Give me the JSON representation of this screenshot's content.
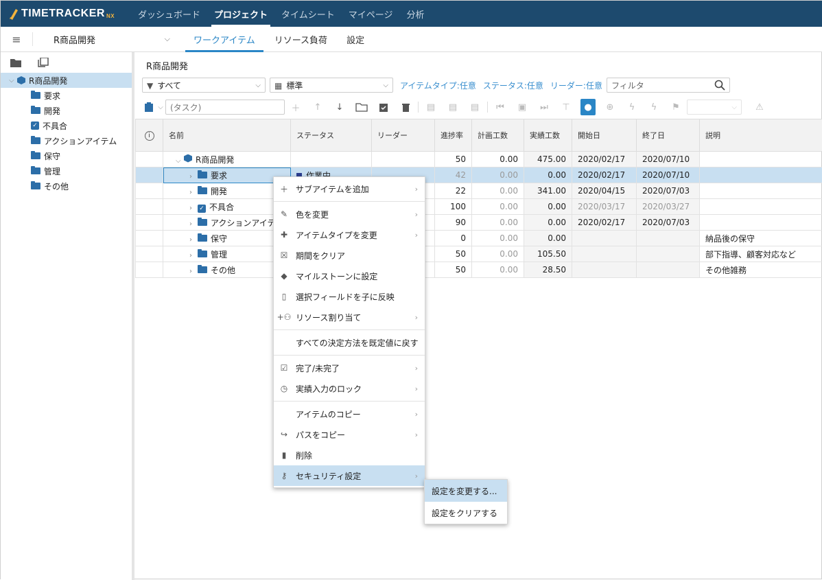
{
  "nav": {
    "logo": "TIMETRACKER",
    "logo_suffix": "NX",
    "items": [
      {
        "label": "ダッシュボード",
        "active": false
      },
      {
        "label": "プロジェクト",
        "active": true
      },
      {
        "label": "タイムシート",
        "active": false
      },
      {
        "label": "マイページ",
        "active": false
      },
      {
        "label": "分析",
        "active": false
      }
    ]
  },
  "subheader": {
    "project": "R商品開発",
    "tabs": [
      {
        "label": "ワークアイテム",
        "active": true
      },
      {
        "label": "リソース負荷",
        "active": false
      },
      {
        "label": "設定",
        "active": false
      }
    ]
  },
  "sidebar": {
    "root": "R商品開発",
    "items": [
      {
        "label": "要求",
        "icon": "folder-icon"
      },
      {
        "label": "開発",
        "icon": "folder-icon"
      },
      {
        "label": "不具合",
        "icon": "checkbox-icon"
      },
      {
        "label": "アクションアイテム",
        "icon": "folder-icon"
      },
      {
        "label": "保守",
        "icon": "folder-icon"
      },
      {
        "label": "管理",
        "icon": "folder-icon"
      },
      {
        "label": "その他",
        "icon": "folder-icon"
      }
    ]
  },
  "main": {
    "title": "R商品開発",
    "filter_select": "すべて",
    "view_select": "標準",
    "filter_links": [
      "アイテムタイプ:任意",
      "ステータス:任意",
      "リーダー:任意"
    ],
    "filter_placeholder": "フィルタ",
    "task_placeholder": "(タスク)"
  },
  "grid": {
    "columns": [
      "名前",
      "ステータス",
      "リーダー",
      "進捗率",
      "計画工数",
      "実績工数",
      "開始日",
      "終了日",
      "説明"
    ],
    "rows": [
      {
        "name": "R商品開発",
        "type": "root",
        "status": "",
        "leader": "",
        "progress": "50",
        "planned": "0.00",
        "actual": "475.00",
        "start": "2020/02/17",
        "end": "2020/07/10",
        "desc": ""
      },
      {
        "name": "要求",
        "type": "folder",
        "status": "作業中",
        "leader": "",
        "progress": "42",
        "planned": "0.00",
        "actual": "0.00",
        "start": "2020/02/17",
        "end": "2020/07/10",
        "desc": "",
        "selected": true
      },
      {
        "name": "開発",
        "type": "folder",
        "status": "",
        "leader": "",
        "progress": "22",
        "planned": "0.00",
        "actual": "341.00",
        "start": "2020/04/15",
        "end": "2020/07/03",
        "desc": ""
      },
      {
        "name": "不具合",
        "type": "check",
        "status": "",
        "leader": "",
        "progress": "100",
        "planned": "0.00",
        "actual": "0.00",
        "start": "2020/03/17",
        "end": "2020/03/27",
        "desc": "",
        "dimdates": true
      },
      {
        "name": "アクションアイテム",
        "type": "folder",
        "status": "",
        "leader": "",
        "progress": "90",
        "planned": "0.00",
        "actual": "0.00",
        "start": "2020/02/17",
        "end": "2020/07/03",
        "desc": ""
      },
      {
        "name": "保守",
        "type": "folder",
        "status": "",
        "leader": "",
        "progress": "0",
        "planned": "0.00",
        "actual": "0.00",
        "start": "",
        "end": "",
        "desc": "納品後の保守"
      },
      {
        "name": "管理",
        "type": "folder",
        "status": "",
        "leader": "",
        "progress": "50",
        "planned": "0.00",
        "actual": "105.50",
        "start": "",
        "end": "",
        "desc": "部下指導、顧客対応など"
      },
      {
        "name": "その他",
        "type": "folder",
        "status": "",
        "leader": "",
        "progress": "50",
        "planned": "0.00",
        "actual": "28.50",
        "start": "",
        "end": "",
        "desc": "その他雑務"
      }
    ]
  },
  "context_menu": {
    "items": [
      {
        "label": "サブアイテムを追加",
        "icon": "plus-icon",
        "sub": true
      },
      {
        "sep": true
      },
      {
        "label": "色を変更",
        "icon": "brush-icon",
        "sub": true
      },
      {
        "label": "アイテムタイプを変更",
        "icon": "puzzle-icon",
        "sub": true
      },
      {
        "label": "期間をクリア",
        "icon": "calendar-x-icon",
        "sub": false
      },
      {
        "label": "マイルストーンに設定",
        "icon": "diamond-icon",
        "sub": false
      },
      {
        "label": "選択フィールドを子に反映",
        "icon": "clipboard-icon",
        "sub": false
      },
      {
        "label": "リソース割り当て",
        "icon": "person-add-icon",
        "sub": true
      },
      {
        "sep": true
      },
      {
        "label": "すべての決定方法を既定値に戻す",
        "icon": "",
        "sub": false
      },
      {
        "sep": true
      },
      {
        "label": "完了/未完了",
        "icon": "clipboard-check-icon",
        "sub": true
      },
      {
        "label": "実績入力のロック",
        "icon": "clock-lock-icon",
        "sub": true
      },
      {
        "sep": true
      },
      {
        "label": "アイテムのコピー",
        "icon": "",
        "sub": true
      },
      {
        "label": "パスをコピー",
        "icon": "share-arrow-icon",
        "sub": true
      },
      {
        "label": "削除",
        "icon": "trash-icon",
        "sub": false
      },
      {
        "label": "セキュリティ設定",
        "icon": "key-icon",
        "sub": true,
        "highlight": true
      }
    ]
  },
  "submenu": {
    "items": [
      "設定を変更する...",
      "設定をクリアする"
    ]
  },
  "colors": {
    "nav_bg": "#1d4a6e",
    "accent": "#2a86c6",
    "selection": "#c8dff1",
    "folder": "#2c6ea8",
    "logo_accent": "#f3b33d"
  }
}
